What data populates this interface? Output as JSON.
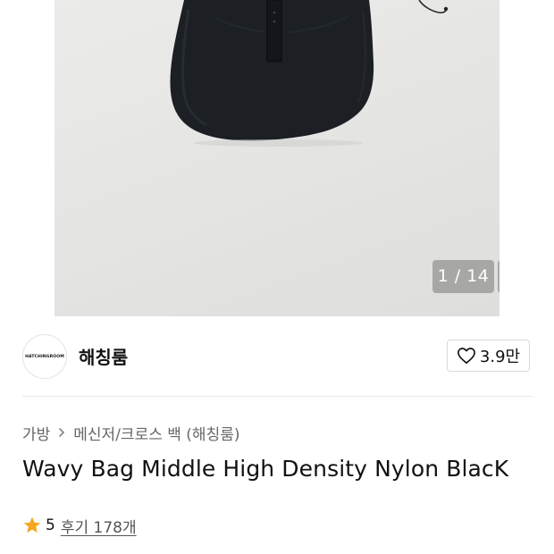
{
  "gallery": {
    "counter": "1 / 14",
    "expand_icon": "expand-arrows-icon"
  },
  "brand": {
    "logo_text": "HATCHINGROOM",
    "name": "해칭룸",
    "like_icon": "heart-outline-icon",
    "like_count": "3.9만"
  },
  "breadcrumb": {
    "items": [
      "가방",
      "메신저/크로스 백 (해칭룸)"
    ],
    "separator_icon": "chevron-right-icon"
  },
  "product": {
    "title": "Wavy Bag Middle High Density Nylon BlacK"
  },
  "rating": {
    "star_icon": "star-icon",
    "star_color": "#f5a623",
    "score": "5",
    "reviews_label": "후기 178개"
  }
}
